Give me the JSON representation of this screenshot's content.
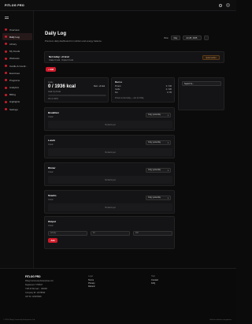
{
  "topbar": {
    "brand": "FITLOG PRO"
  },
  "sidebar": {
    "items": [
      {
        "label": "Overview",
        "active": false
      },
      {
        "label": "Daily Log",
        "active": true
      },
      {
        "label": "Library",
        "active": false
      },
      {
        "label": "My Foods",
        "active": false
      },
      {
        "label": "Workouts",
        "active": false
      },
      {
        "label": "Cardio & Condi...",
        "active": false
      },
      {
        "label": "Exercises",
        "active": false
      },
      {
        "label": "Programs",
        "active": false
      },
      {
        "label": "Analytics",
        "active": false
      },
      {
        "label": "Billing",
        "active": false
      },
      {
        "label": "Highlights",
        "active": false
      },
      {
        "label": "Settings",
        "active": false
      }
    ]
  },
  "header": {
    "title": "Daily Log",
    "subtitle": "Premium daily dashboard for nutrition and energy balance.",
    "view_label": "View",
    "view_value": "Day",
    "date_value": "Jul 28, 2025"
  },
  "banner": {
    "title": "Net today: +0 kcal",
    "subtitle": "Intake 0 kcal · Output 0 kcal",
    "action": "Quick action"
  },
  "add_food_label": "+ Add",
  "intake": {
    "label": "Intake",
    "value": "0 / 1936 kcal",
    "sub": "Goal: by 0 kcal",
    "remaining": "Rem: +0 kcal",
    "progress": 0,
    "percent": "0% of 100%"
  },
  "macros": {
    "title": "Macros",
    "rows": [
      {
        "name": "Protein",
        "value": "0 / 160"
      },
      {
        "name": "Carbs",
        "value": "0 / 180"
      },
      {
        "name": "Fat",
        "value": "0 / 65"
      }
    ],
    "hint": "Protein is low today — aim for 160g"
  },
  "side_box": {
    "label": "Search fo..."
  },
  "meals": [
    {
      "name": "Breakfast",
      "kcal": "0 kcal",
      "copy": "Copy yesterday",
      "empty": "No items yet"
    },
    {
      "name": "Lunch",
      "kcal": "0 kcal",
      "copy": "Copy yesterday",
      "empty": "No items yet"
    },
    {
      "name": "Dinner",
      "kcal": "0 kcal",
      "copy": "Copy yesterday",
      "empty": "No items yet"
    },
    {
      "name": "Snacks",
      "kcal": "0 kcal",
      "copy": "Copy yesterday",
      "empty": "No items yet"
    }
  ],
  "output": {
    "name": "Output",
    "kcal": "0 kcal",
    "field1": "Activity",
    "field2": "30",
    "field3": "200",
    "add": "Add"
  },
  "footer": {
    "brand": "FITLOG PRO",
    "lines": [
      "Fitlog Community Enterprises Ltd.",
      "Registered: 7760517",
      "7425 W Dixmarn · GB4FR",
      "Company ID: 12378990",
      "VAT ID: 123978990"
    ],
    "cols": [
      {
        "heading": "Legal",
        "links": [
          "Terms",
          "Privacy",
          "Refund"
        ]
      },
      {
        "heading": "Help",
        "links": [
          "Contact",
          "FAQ"
        ]
      }
    ],
    "copyright": "© 2025 Fitlog Community Enterprises Ltd.",
    "made": "Built for athletes everywhere"
  },
  "colors": {
    "accent": "#d11a2a",
    "bg": "#0b0b0c",
    "card": "#141416"
  }
}
